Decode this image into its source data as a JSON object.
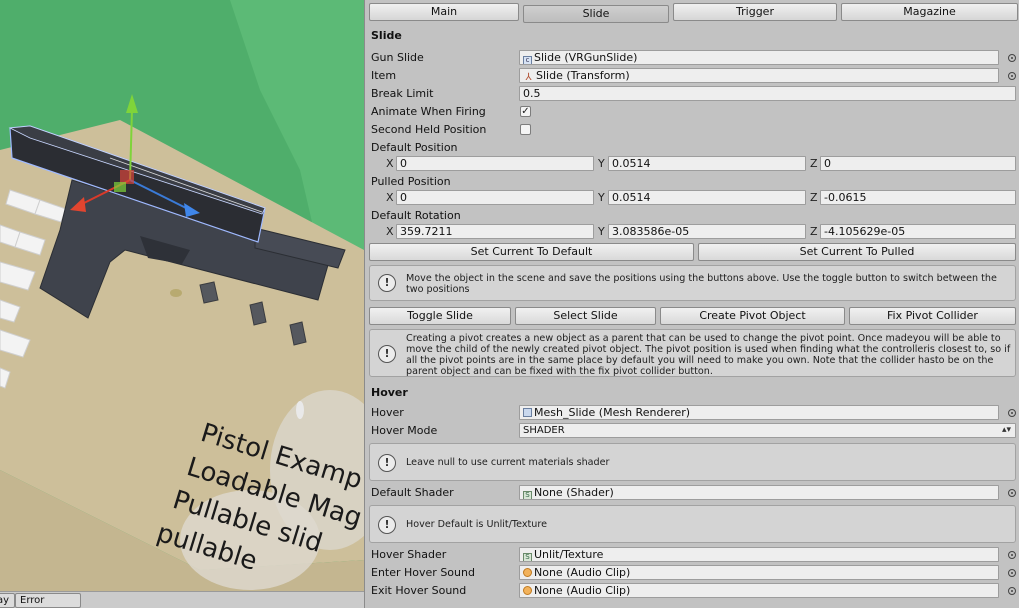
{
  "scene": {
    "labels": [
      "Pistol Examp",
      "Loadable Mag",
      "Pullable slid",
      "pullable"
    ]
  },
  "status": {
    "play_label": "ay",
    "error_pause_label": "Error Pause"
  },
  "tabs": [
    {
      "label": "Main",
      "active": false
    },
    {
      "label": "Slide",
      "active": true
    },
    {
      "label": "Trigger",
      "active": false
    },
    {
      "label": "Magazine",
      "active": false
    }
  ],
  "slide": {
    "title": "Slide",
    "gun_slide_label": "Gun Slide",
    "gun_slide_value": "Slide (VRGunSlide)",
    "item_label": "Item",
    "item_value": "Slide (Transform)",
    "break_limit_label": "Break Limit",
    "break_limit_value": "0.5",
    "animate_label": "Animate When Firing",
    "animate_checked": "✓",
    "second_held_label": "Second Held Position",
    "second_held_checked": "",
    "default_position_label": "Default Position",
    "default_position": {
      "x": "0",
      "y": "0.0514",
      "z": "0"
    },
    "pulled_position_label": "Pulled Position",
    "pulled_position": {
      "x": "0",
      "y": "0.0514",
      "z": "-0.0615"
    },
    "default_rotation_label": "Default Rotation",
    "default_rotation": {
      "x": "359.7211",
      "y": "3.083586e-05",
      "z": "-4.105629e-05"
    },
    "axis_labels": {
      "x": "X",
      "y": "Y",
      "z": "Z"
    },
    "set_default_button": "Set Current To Default",
    "set_pulled_button": "Set Current To Pulled",
    "help_positions": "Move the object in the scene and save the positions using the buttons above. Use the toggle button to switch between the two positions",
    "toggle_slide_button": "Toggle Slide",
    "select_slide_button": "Select Slide",
    "create_pivot_button": "Create Pivot Object",
    "fix_pivot_button": "Fix Pivot Collider",
    "help_pivot": "Creating a pivot creates a new object as a parent that can be used to change the pivot point. Once madeyou will be able to move the child of the newly created pivot object. The pivot position is used when finding what the controlleris closest to, so if all the pivot points are in the same place by default you will need to make you own. Note that the collider hasto be on the parent object and can be fixed with the fix pivot collider button."
  },
  "hover": {
    "title": "Hover",
    "hover_label": "Hover",
    "hover_value": "Mesh_Slide (Mesh Renderer)",
    "hover_mode_label": "Hover Mode",
    "hover_mode_value": "SHADER",
    "help_null": "Leave null to use current materials shader",
    "default_shader_label": "Default Shader",
    "default_shader_value": "None (Shader)",
    "help_default": "Hover Default is Unlit/Texture",
    "hover_shader_label": "Hover Shader",
    "hover_shader_value": "Unlit/Texture",
    "enter_sound_label": "Enter Hover Sound",
    "enter_sound_value": "None (Audio Clip)",
    "exit_sound_label": "Exit Hover Sound",
    "exit_sound_value": "None (Audio Clip)"
  },
  "icons": {
    "help": "!",
    "dropdown": "▴▾"
  }
}
